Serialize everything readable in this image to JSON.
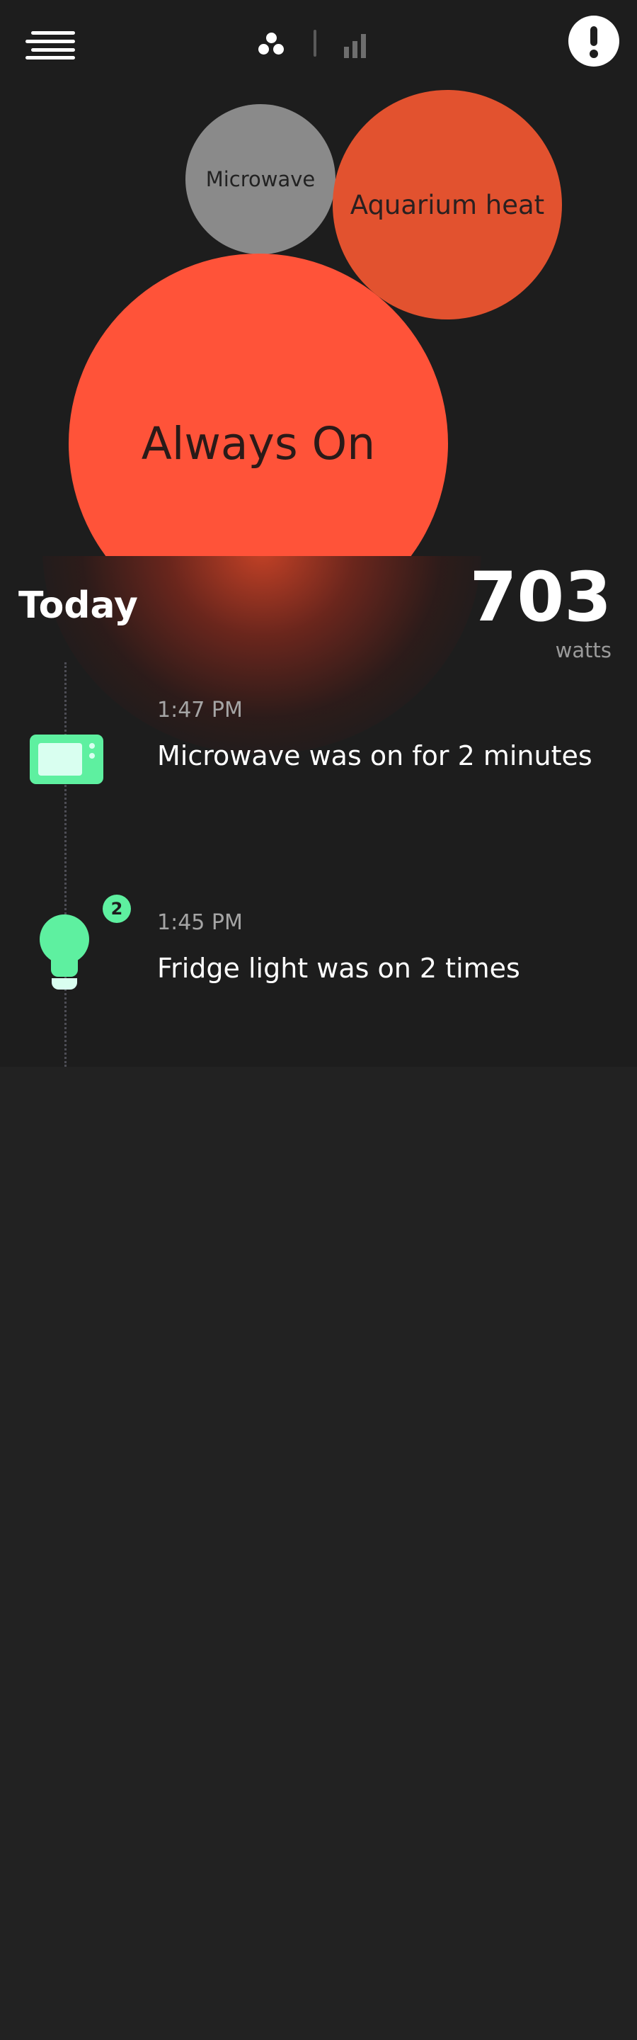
{
  "header": {
    "menu_icon": "hamburger-menu-icon",
    "view_toggle": {
      "bubbles_icon": "bubbles-view-icon",
      "bars_icon": "bar-chart-icon"
    },
    "alert_icon": "exclamation-icon"
  },
  "bubbles": [
    {
      "label": "Microwave",
      "color": "#8a8a8a"
    },
    {
      "label": "Aquarium heat",
      "color": "#e2522f"
    },
    {
      "label": "Always On",
      "color": "#ff5339"
    }
  ],
  "today": {
    "title": "Today",
    "usage_value": "703",
    "usage_unit": "watts"
  },
  "events": [
    {
      "time": "1:47 PM",
      "text": "Microwave was on for 2 minutes",
      "icon": "microwave-icon"
    },
    {
      "time": "1:45 PM",
      "text": "Fridge light was on 2 times",
      "icon": "light-bulb-icon",
      "badge": "2"
    }
  ],
  "colors": {
    "background": "#1d1d1d",
    "accent_green": "#5ef0a0",
    "accent_red": "#ff5339"
  }
}
